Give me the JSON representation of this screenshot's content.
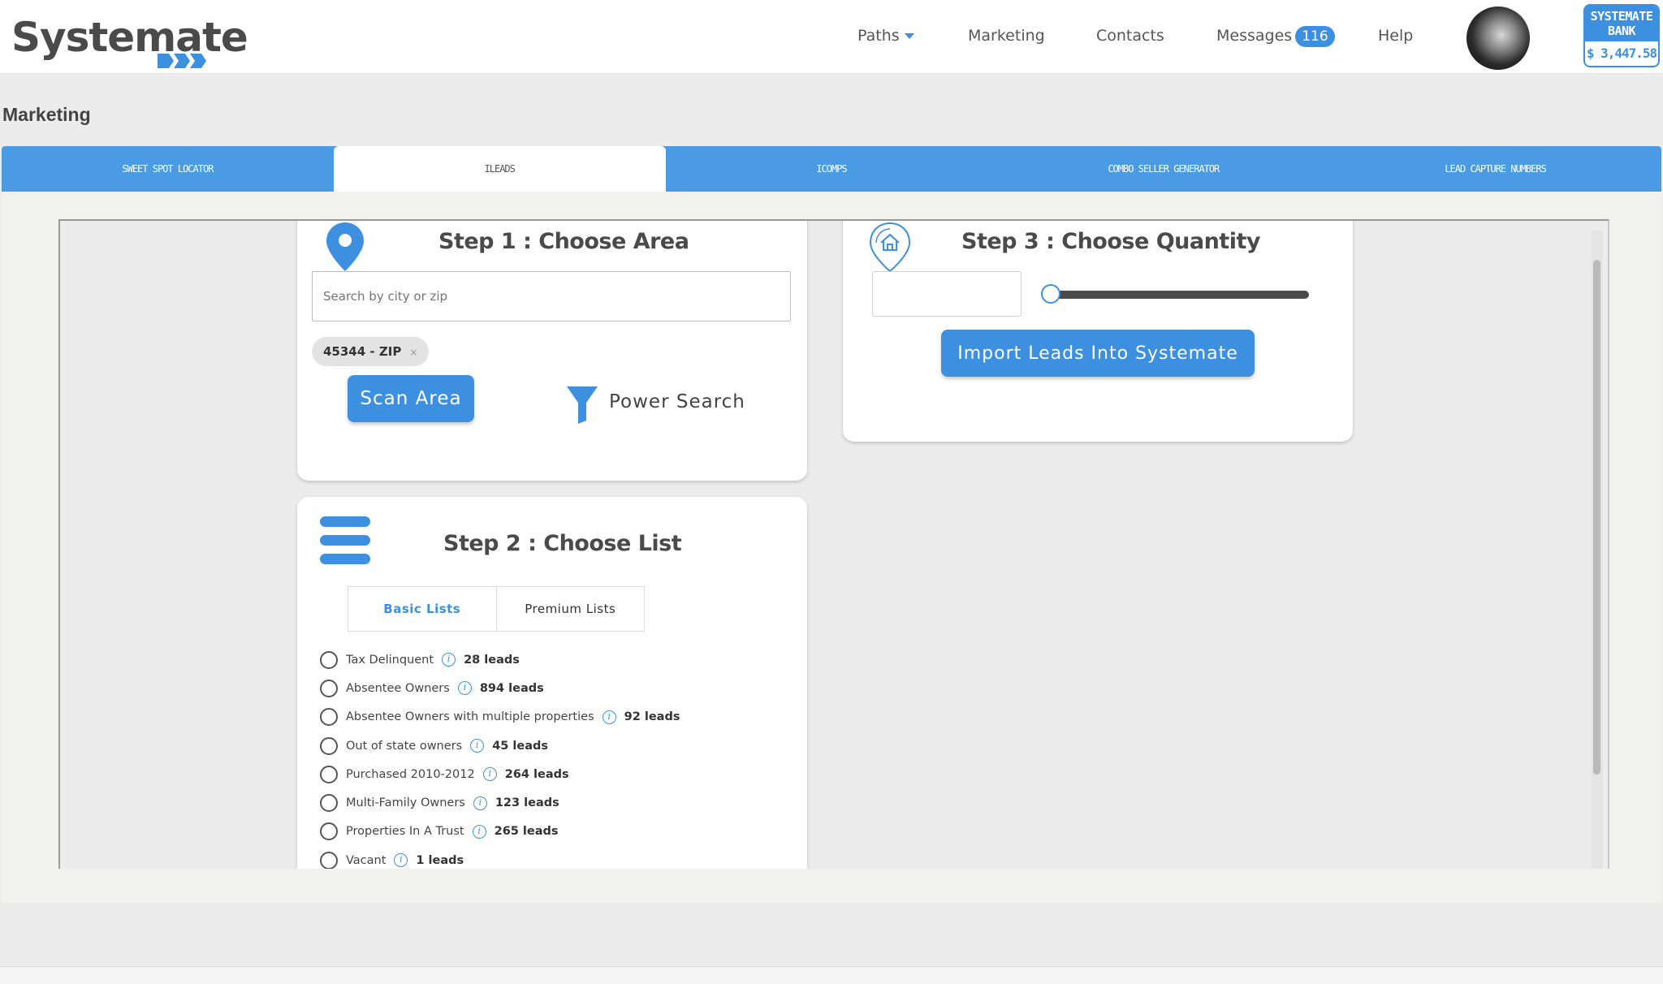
{
  "header": {
    "logo_text": "Systemate",
    "nav": {
      "paths": "Paths",
      "marketing": "Marketing",
      "contacts": "Contacts",
      "messages": "Messages",
      "messages_badge": "116",
      "help": "Help"
    },
    "bank": {
      "line1": "SYSTEMATE",
      "line2": "BANK",
      "amount": "$ 3,447.58"
    }
  },
  "page_title": "Marketing",
  "tabs": [
    {
      "label": "Sweet Spot Locator"
    },
    {
      "label": "iLeads"
    },
    {
      "label": "iComps"
    },
    {
      "label": "Combo Seller Generator"
    },
    {
      "label": "Lead Capture Numbers"
    }
  ],
  "step1": {
    "title": "Step 1 : Choose Area",
    "search_placeholder": "Search by city or zip",
    "chip_label": "45344 - ZIP",
    "chip_remove": "×",
    "scan_button": "Scan Area",
    "power_search": "Power Search"
  },
  "step3": {
    "title": "Step 3 : Choose Quantity",
    "quantity_value": "",
    "slider_value": 0,
    "import_button": "Import Leads Into Systemate"
  },
  "step2": {
    "title": "Step 2 : Choose List",
    "tab_basic": "Basic Lists",
    "tab_premium": "Premium Lists",
    "lists": [
      {
        "name": "Tax Delinquent",
        "count": "28 leads"
      },
      {
        "name": "Absentee Owners",
        "count": "894 leads"
      },
      {
        "name": "Absentee Owners with multiple properties",
        "count": "92 leads"
      },
      {
        "name": "Out of state owners",
        "count": "45 leads"
      },
      {
        "name": "Purchased 2010-2012",
        "count": "264 leads"
      },
      {
        "name": "Multi-Family Owners",
        "count": "123 leads"
      },
      {
        "name": "Properties In A Trust",
        "count": "265 leads"
      },
      {
        "name": "Vacant",
        "count": "1 leads"
      }
    ]
  },
  "colors": {
    "accent": "#3d8fe0",
    "tab_bar": "#4a9be4",
    "page_bg": "#ececed"
  }
}
